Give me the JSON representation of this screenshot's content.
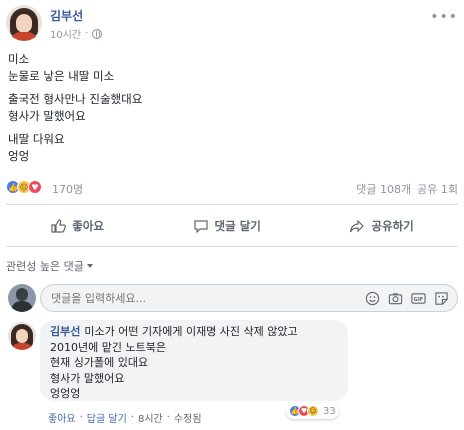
{
  "post": {
    "author": "김부선",
    "time": "10시간",
    "privacy_icon": "globe-icon",
    "lines": [
      "미소",
      "눈물로 낳은 내딸 미소",
      "출국전 형사만나 진술했대요",
      "형사가 말했어요",
      "내딸 다워요",
      "엉엉"
    ]
  },
  "reactions": {
    "icons": [
      "like-icon",
      "sad-icon",
      "love-icon"
    ],
    "count": "170명",
    "comments": "댓글 108개",
    "shares": "공유 1회"
  },
  "actions": {
    "like": "좋아요",
    "comment": "댓글 달기",
    "share": "공유하기"
  },
  "comments_section": {
    "sort_label": "관련성 높은 댓글",
    "composer_placeholder": "댓글을 입력하세요...",
    "composer_icons": [
      "emoji-icon",
      "camera-icon",
      "gif-icon",
      "sticker-icon"
    ]
  },
  "comment": {
    "author": "김부선",
    "lines": [
      "미소가 어떤 기자에게 이재명 사진 삭제 않았고",
      "2010년에 맡긴 노트북은",
      "현재 싱가폴에 있대요",
      "형사가 말했어요",
      "엉엉엉"
    ],
    "footer": {
      "like": "좋아요",
      "reply": "답글 달기",
      "time": "8시간",
      "edited": "수정됨"
    },
    "reaction_count": "33"
  },
  "colors": {
    "link_blue": "#365899",
    "like_blue": "#4a7ce8",
    "love_red": "#ed4a5d",
    "sad_yellow": "#f7c542"
  }
}
